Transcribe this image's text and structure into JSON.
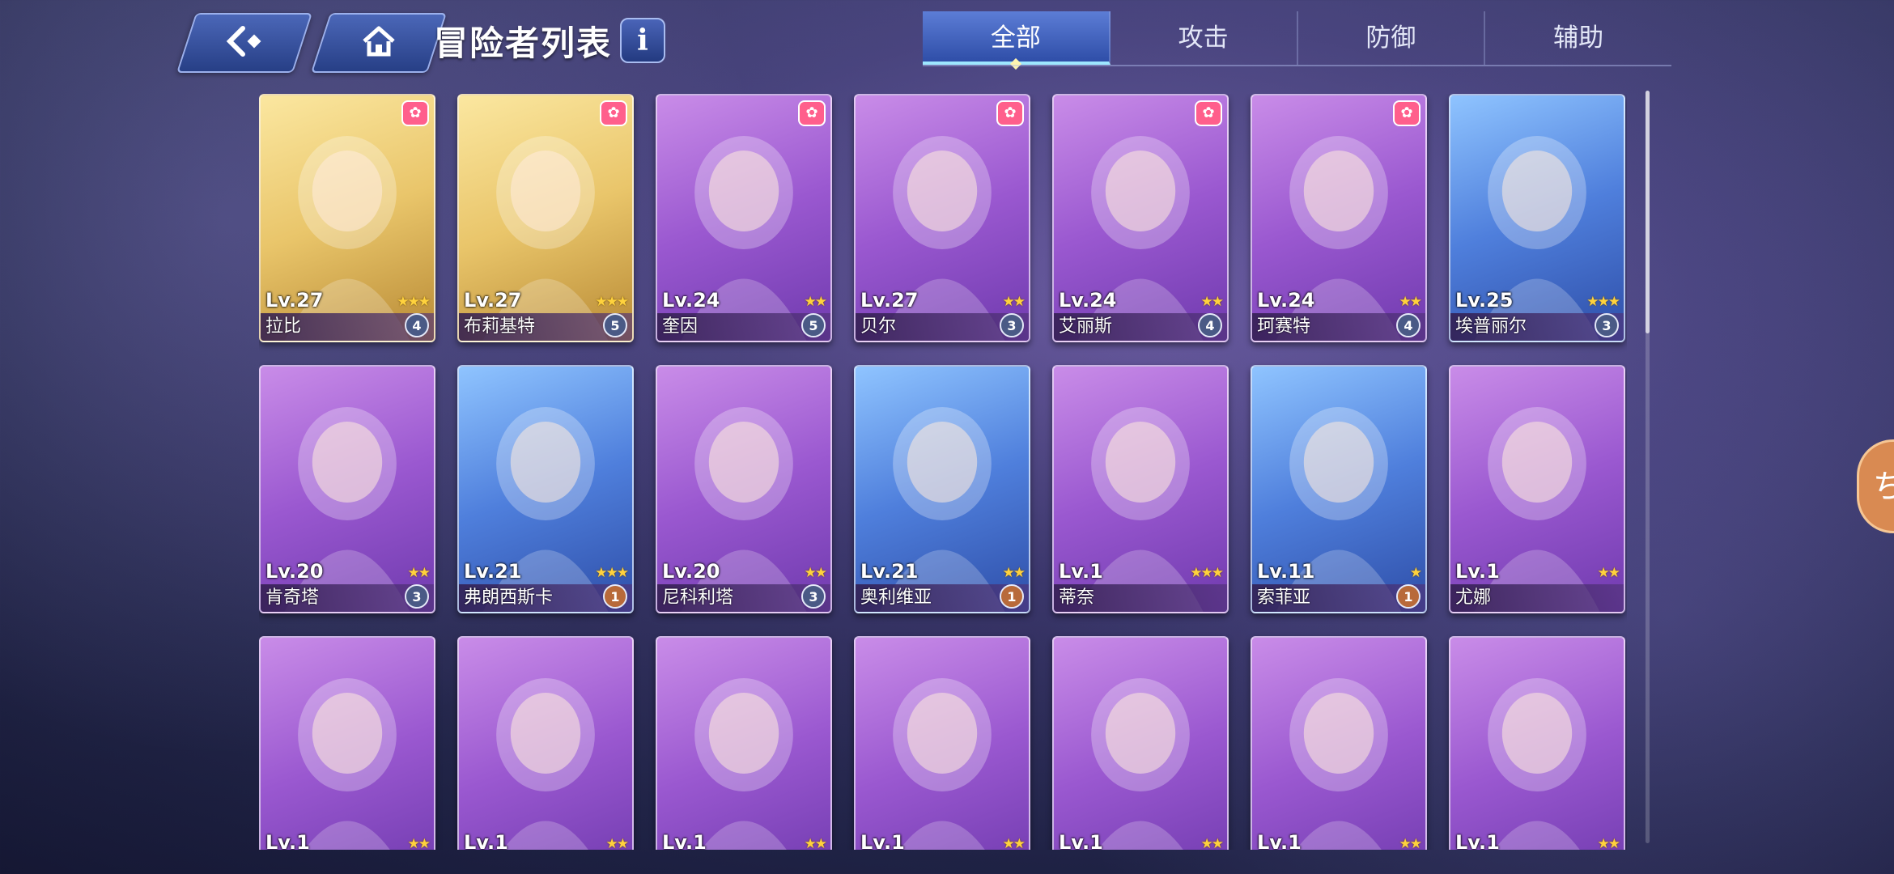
{
  "header": {
    "title": "冒险者列表",
    "info_label": "i"
  },
  "tabs": [
    {
      "label": "全部",
      "active": true
    },
    {
      "label": "攻击",
      "active": false
    },
    {
      "label": "防御",
      "active": false
    },
    {
      "label": "辅助",
      "active": false
    }
  ],
  "cards": [
    {
      "level": "Lv.27",
      "name": "拉比",
      "stars": "★★★",
      "rank": "4",
      "frame": "gold",
      "paw": true
    },
    {
      "level": "Lv.27",
      "name": "布莉基特",
      "stars": "★★★",
      "rank": "5",
      "frame": "gold",
      "paw": true
    },
    {
      "level": "Lv.24",
      "name": "奎因",
      "stars": "★★",
      "rank": "5",
      "frame": "purple",
      "paw": true
    },
    {
      "level": "Lv.27",
      "name": "贝尔",
      "stars": "★★",
      "rank": "3",
      "frame": "purple",
      "paw": true
    },
    {
      "level": "Lv.24",
      "name": "艾丽斯",
      "stars": "★★",
      "rank": "4",
      "frame": "purple",
      "paw": true
    },
    {
      "level": "Lv.24",
      "name": "珂赛特",
      "stars": "★★",
      "rank": "4",
      "frame": "purple",
      "paw": true
    },
    {
      "level": "Lv.25",
      "name": "埃普丽尔",
      "stars": "★★★",
      "rank": "3",
      "frame": "blue",
      "paw": false
    },
    {
      "level": "Lv.20",
      "name": "肯奇塔",
      "stars": "★★",
      "rank": "3",
      "frame": "purple",
      "paw": false
    },
    {
      "level": "Lv.21",
      "name": "弗朗西斯卡",
      "stars": "★★★",
      "rank": "1",
      "frame": "blue",
      "paw": false
    },
    {
      "level": "Lv.20",
      "name": "尼科利塔",
      "stars": "★★",
      "rank": "3",
      "frame": "purple",
      "paw": false
    },
    {
      "level": "Lv.21",
      "name": "奥利维亚",
      "stars": "★★",
      "rank": "1",
      "frame": "blue",
      "paw": false
    },
    {
      "level": "Lv.1",
      "name": "蒂奈",
      "stars": "★★★",
      "rank": "",
      "frame": "purple",
      "paw": false
    },
    {
      "level": "Lv.11",
      "name": "索菲亚",
      "stars": "★",
      "rank": "1",
      "frame": "blue",
      "paw": false
    },
    {
      "level": "Lv.1",
      "name": "尤娜",
      "stars": "★★",
      "rank": "",
      "frame": "purple",
      "paw": false
    },
    {
      "level": "Lv.1",
      "name": "",
      "stars": "★★",
      "rank": "",
      "frame": "purple",
      "paw": false
    },
    {
      "level": "Lv.1",
      "name": "",
      "stars": "★★",
      "rank": "",
      "frame": "purple",
      "paw": false
    },
    {
      "level": "Lv.1",
      "name": "",
      "stars": "★★",
      "rank": "",
      "frame": "purple",
      "paw": false
    },
    {
      "level": "Lv.1",
      "name": "",
      "stars": "★★",
      "rank": "",
      "frame": "purple",
      "paw": false
    },
    {
      "level": "Lv.1",
      "name": "",
      "stars": "★★",
      "rank": "",
      "frame": "purple",
      "paw": false
    },
    {
      "level": "Lv.1",
      "name": "",
      "stars": "★★",
      "rank": "",
      "frame": "purple",
      "paw": false
    },
    {
      "level": "Lv.1",
      "name": "",
      "stars": "★★",
      "rank": "",
      "frame": "purple",
      "paw": false
    }
  ]
}
